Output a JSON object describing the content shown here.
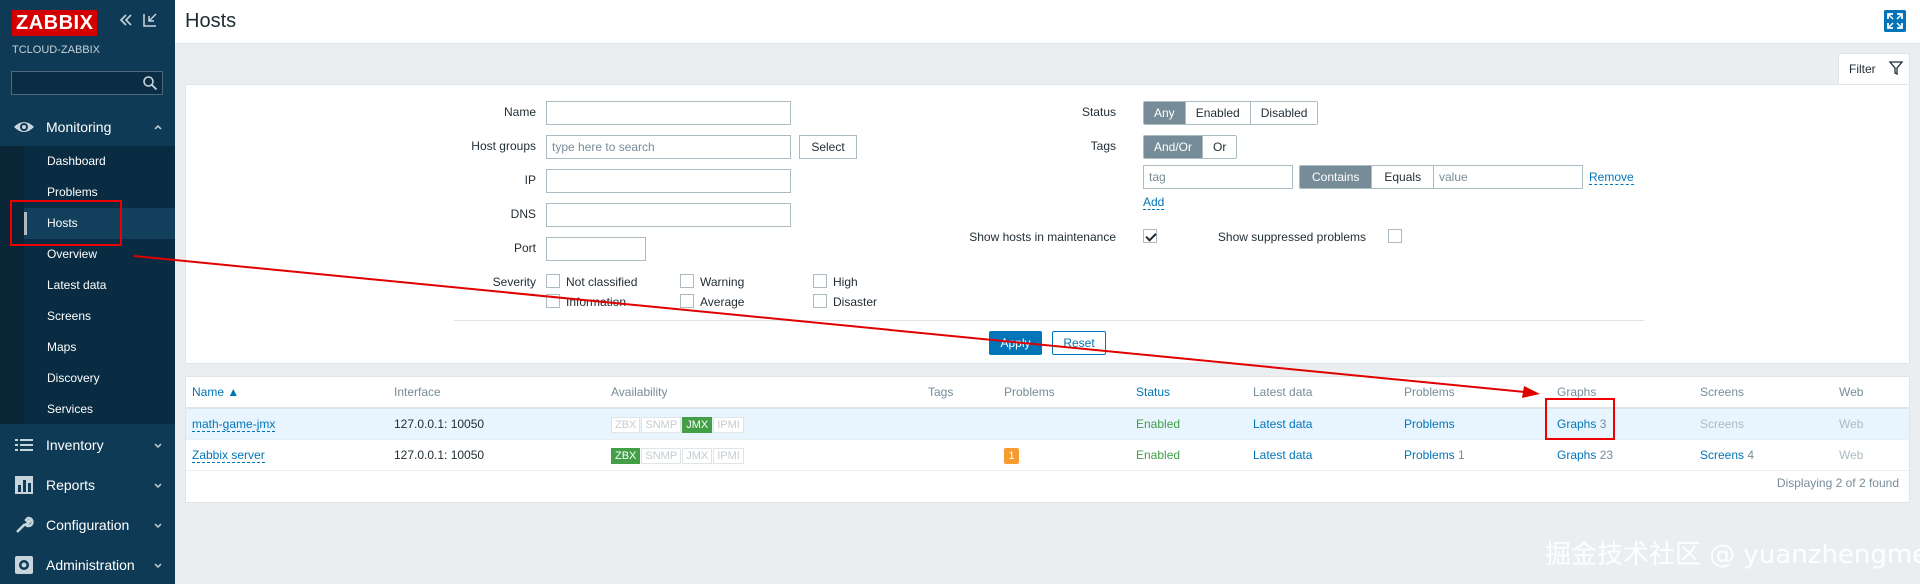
{
  "app": {
    "logo": "ZABBIX",
    "server_name": "TCLOUD-ZABBIX"
  },
  "header": {
    "title": "Hosts"
  },
  "sidebar": {
    "monitoring": {
      "label": "Monitoring"
    },
    "monitoring_items": [
      {
        "label": "Dashboard"
      },
      {
        "label": "Problems"
      },
      {
        "label": "Hosts",
        "active": true
      },
      {
        "label": "Overview"
      },
      {
        "label": "Latest data"
      },
      {
        "label": "Screens"
      },
      {
        "label": "Maps"
      },
      {
        "label": "Discovery"
      },
      {
        "label": "Services"
      }
    ],
    "sections": [
      {
        "label": "Inventory",
        "icon": "list-icon"
      },
      {
        "label": "Reports",
        "icon": "bar-chart-icon"
      },
      {
        "label": "Configuration",
        "icon": "wrench-icon"
      },
      {
        "label": "Administration",
        "icon": "gear-icon"
      }
    ]
  },
  "filter": {
    "tab_label": "Filter",
    "name_label": "Name",
    "name_value": "",
    "host_groups_label": "Host groups",
    "host_groups_placeholder": "type here to search",
    "select_label": "Select",
    "ip_label": "IP",
    "dns_label": "DNS",
    "port_label": "Port",
    "severity_label": "Severity",
    "severities": [
      "Not classified",
      "Warning",
      "High",
      "Information",
      "Average",
      "Disaster"
    ],
    "status_label": "Status",
    "status_options": [
      "Any",
      "Enabled",
      "Disabled"
    ],
    "status_selected": "Any",
    "tags_label": "Tags",
    "tags_options": [
      "And/Or",
      "Or"
    ],
    "tags_selected": "And/Or",
    "tag_placeholder": "tag",
    "tag_operators": [
      "Contains",
      "Equals"
    ],
    "tag_operator_selected": "Contains",
    "value_placeholder": "value",
    "remove_label": "Remove",
    "add_label": "Add",
    "maintenance_label": "Show hosts in maintenance",
    "maintenance_checked": true,
    "suppressed_label": "Show suppressed problems",
    "suppressed_checked": false,
    "apply_label": "Apply",
    "reset_label": "Reset"
  },
  "table": {
    "columns": [
      "Name ▲",
      "Interface",
      "Availability",
      "Tags",
      "Problems",
      "Status",
      "Latest data",
      "Problems",
      "Graphs",
      "Screens",
      "Web"
    ],
    "rows": [
      {
        "name": "math-game-jmx",
        "interface": "127.0.0.1: 10050",
        "availability": [
          "ZBX",
          "SNMP",
          "JMX",
          "IPMI"
        ],
        "availability_active": "JMX",
        "problems_badge": "",
        "status": "Enabled",
        "latest_data": "Latest data",
        "problems_link": "Problems",
        "problems_count": "",
        "graphs_link": "Graphs",
        "graphs_count": "3",
        "screens": "Screens",
        "screens_count": "",
        "web": "Web"
      },
      {
        "name": "Zabbix server",
        "interface": "127.0.0.1: 10050",
        "availability": [
          "ZBX",
          "SNMP",
          "JMX",
          "IPMI"
        ],
        "availability_active": "ZBX",
        "problems_badge": "1",
        "status": "Enabled",
        "latest_data": "Latest data",
        "problems_link": "Problems",
        "problems_count": "1",
        "graphs_link": "Graphs",
        "graphs_count": "23",
        "screens": "Screens",
        "screens_count": "4",
        "web": "Web"
      }
    ],
    "footer": "Displaying 2 of 2 found"
  },
  "watermark": "掘金技术社区 @ yuanzhengme",
  "colors": {
    "sidebar": "#0e3a55",
    "accent": "#0275b8",
    "annotation": "#e00000",
    "logo": "#d40000"
  }
}
